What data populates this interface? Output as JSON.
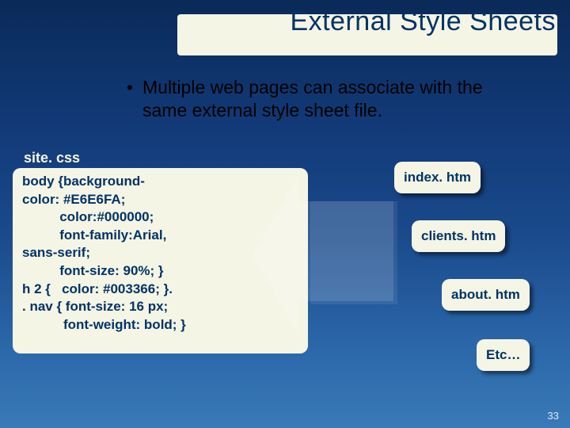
{
  "title": "External Style Sheets",
  "bullet_prefix": "•",
  "bullet_text": "Multiple web pages can associate with the same external style sheet file.",
  "css_filename": "site. css",
  "code": "body {background-\ncolor: #E6E6FA;\n          color:#000000;\n          font-family:Arial,\nsans-serif;\n          font-size: 90%; }\nh 2 {   color: #003366; }.\n. nav { font-size: 16 px;\n           font-weight: bold; }",
  "files": {
    "f1": "index. htm",
    "f2": "clients. htm",
    "f3": "about. htm",
    "f4": "Etc…"
  },
  "page_number": "33"
}
